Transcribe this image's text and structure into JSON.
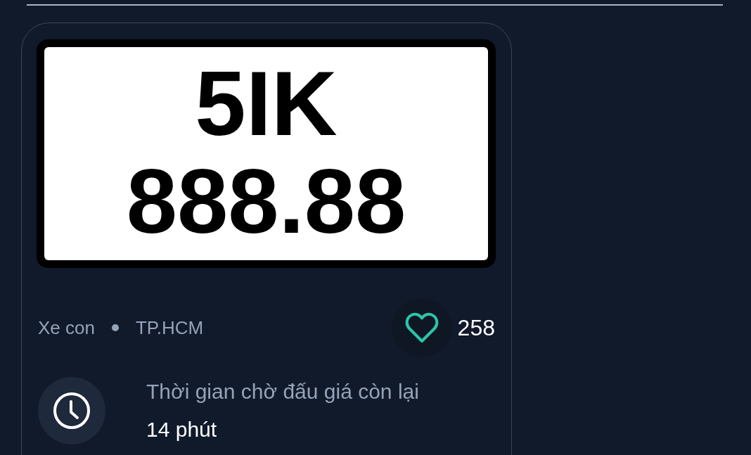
{
  "plate": {
    "line_1": "5IK",
    "line_2": "888.88"
  },
  "meta": {
    "vehicle_type": "Xe con",
    "location": "TP.HCM"
  },
  "likes": {
    "count": "258"
  },
  "countdown": {
    "label": "Thời gian chờ đấu giá còn lại",
    "value": "14 phút"
  }
}
